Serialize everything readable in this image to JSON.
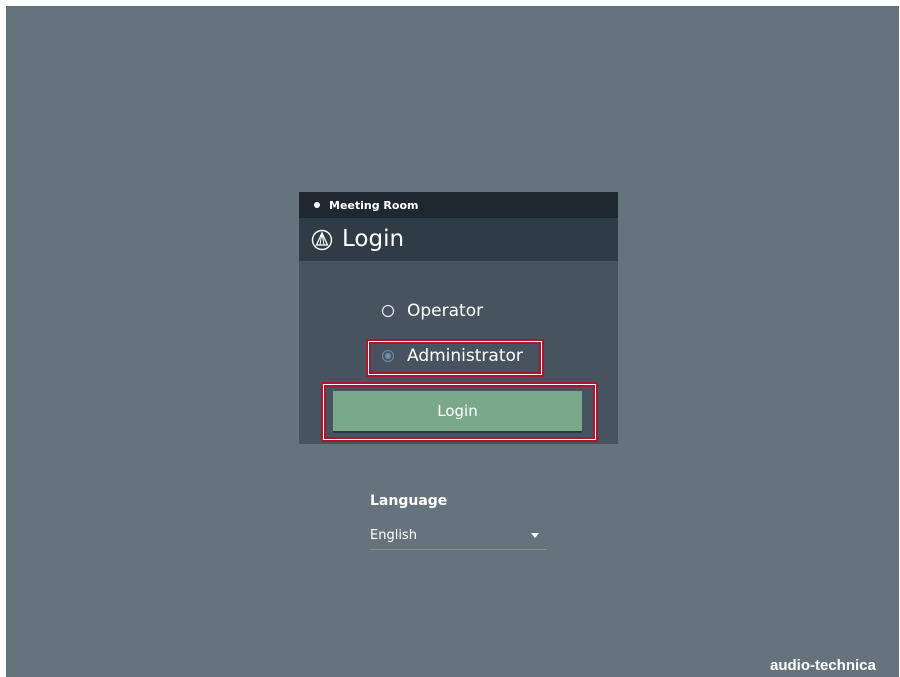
{
  "room": {
    "name": "Meeting Room"
  },
  "login": {
    "title": "Login",
    "roles": [
      {
        "label": "Operator",
        "selected": false
      },
      {
        "label": "Administrator",
        "selected": true
      }
    ],
    "button_label": "Login"
  },
  "language": {
    "label": "Language",
    "selected": "English"
  },
  "brand": {
    "name": "audio-technica"
  },
  "colors": {
    "background": "#66737c",
    "card": "#47545f",
    "header": "#2f3b45",
    "top_bar": "#1f2830",
    "button": "#7aa98a",
    "highlight": "#a5182f",
    "accent": "#6f8fb3"
  },
  "icons": {
    "brand_icon": "audio-technica-logo-icon",
    "dropdown_icon": "caret-down-icon"
  }
}
